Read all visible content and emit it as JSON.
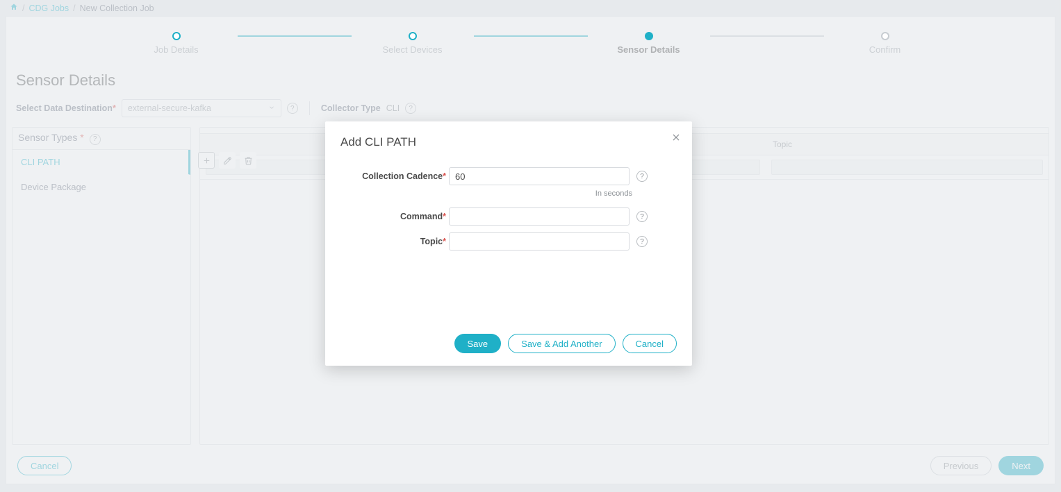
{
  "breadcrumb": {
    "items": [
      "CDG Jobs",
      "New Collection Job"
    ]
  },
  "stepper": {
    "steps": [
      "Job Details",
      "Select Devices",
      "Sensor Details",
      "Confirm"
    ],
    "activeIndex": 2
  },
  "page": {
    "title": "Sensor Details",
    "destinationLabel": "Select Data Destination",
    "destinationValue": "external-secure-kafka",
    "collectorTypeLabel": "Collector Type",
    "collectorTypeValue": "CLI"
  },
  "sensorTypes": {
    "label": "Sensor Types",
    "items": [
      "CLI PATH",
      "Device Package"
    ],
    "activeIndex": 0
  },
  "table": {
    "headers": [
      "",
      "",
      "Topic"
    ]
  },
  "footer": {
    "cancel": "Cancel",
    "previous": "Previous",
    "next": "Next"
  },
  "modal": {
    "title": "Add CLI PATH",
    "fields": {
      "cadence": {
        "label": "Collection Cadence",
        "value": "60",
        "hint": "In seconds"
      },
      "command": {
        "label": "Command",
        "value": ""
      },
      "topic": {
        "label": "Topic",
        "value": ""
      }
    },
    "actions": {
      "save": "Save",
      "saveAnother": "Save & Add Another",
      "cancel": "Cancel"
    }
  }
}
